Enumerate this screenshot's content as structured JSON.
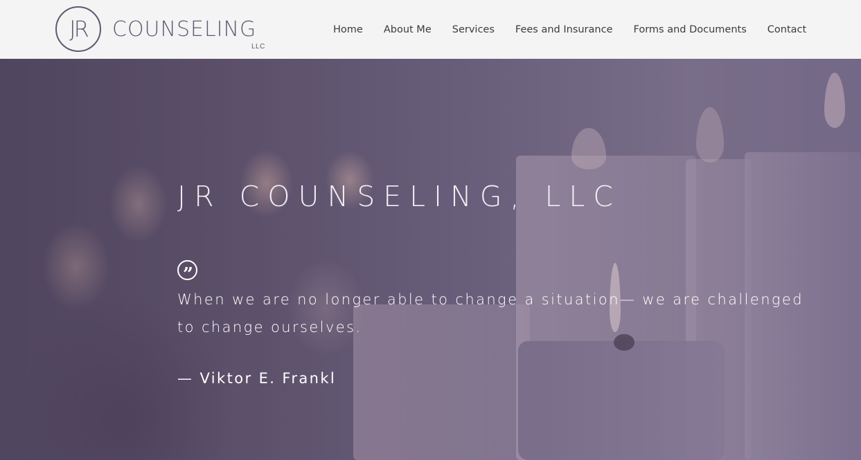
{
  "header": {
    "logo": {
      "monogram": "JR",
      "wordmark": "COUNSELING",
      "suffix": "LLC",
      "color": "#5f5870"
    },
    "nav": [
      {
        "label": "Home"
      },
      {
        "label": "About Me"
      },
      {
        "label": "Services"
      },
      {
        "label": "Fees and Insurance"
      },
      {
        "label": "Forms and Documents"
      },
      {
        "label": "Contact"
      }
    ]
  },
  "hero": {
    "title": "JR COUNSELING, LLC",
    "quote_icon": "quote-icon",
    "quote": "When we are no longer able to change a situation— we are challenged to change ourselves.",
    "author": "— Viktor E. Frankl",
    "background": "candles-photo"
  }
}
